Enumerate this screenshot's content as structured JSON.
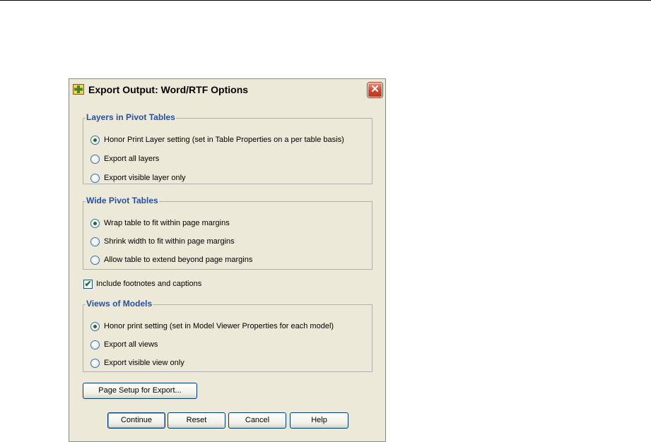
{
  "dialog": {
    "title": "Export Output: Word/RTF Options",
    "close_glyph": "✕",
    "app_icon": "spss-app-icon"
  },
  "layers": {
    "title": "Layers in Pivot Tables",
    "options": [
      {
        "label": "Honor Print Layer setting (set in Table Properties on a per table basis)",
        "selected": true
      },
      {
        "label": "Export all layers",
        "selected": false
      },
      {
        "label": "Export visible layer only",
        "selected": false
      }
    ]
  },
  "wide": {
    "title": "Wide Pivot Tables",
    "options": [
      {
        "label": "Wrap table to fit within page margins",
        "selected": true
      },
      {
        "label": "Shrink width to fit within page margins",
        "selected": false
      },
      {
        "label": "Allow table to extend beyond page margins",
        "selected": false
      }
    ]
  },
  "footnotes": {
    "label": "Include footnotes and captions",
    "checked": true,
    "check_glyph": "✔"
  },
  "views": {
    "title": "Views of Models",
    "options": [
      {
        "label": "Honor print setting (set in Model Viewer Properties for each model)",
        "selected": true
      },
      {
        "label": "Export all views",
        "selected": false
      },
      {
        "label": "Export visible view only",
        "selected": false
      }
    ]
  },
  "buttons": {
    "page_setup": "Page Setup for Export...",
    "continue": "Continue",
    "reset": "Reset",
    "cancel": "Cancel",
    "help": "Help"
  },
  "colors": {
    "dialog_bg": "#ece9d8",
    "group_title": "#2850a0",
    "close_red": "#d0452a"
  }
}
